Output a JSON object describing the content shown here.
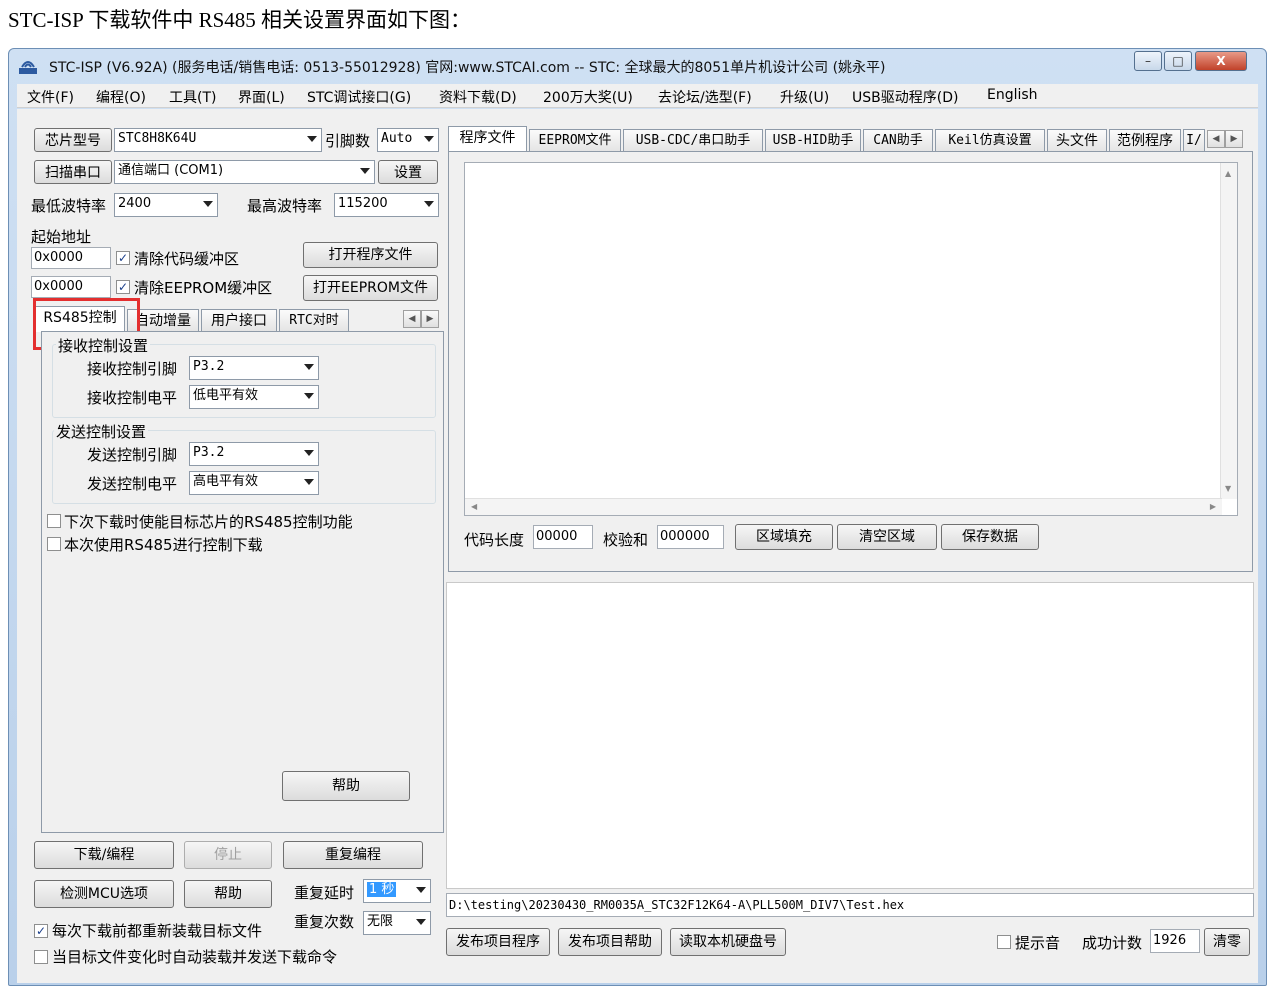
{
  "caption": "STC-ISP 下载软件中 RS485 相关设置界面如下图：",
  "window": {
    "title": "STC-ISP (V6.92A) (服务电话/销售电话: 0513-55012928) 官网:www.STCAI.com  -- STC: 全球最大的8051单片机设计公司 (姚永平)",
    "minimize": "–",
    "maximize": "□",
    "close": "X"
  },
  "menu": [
    "文件(F)",
    "编程(O)",
    "工具(T)",
    "界面(L)",
    "STC调试接口(G)",
    "资料下载(D)",
    "200万大奖(U)",
    "去论坛/选型(F)",
    "升级(U)",
    "USB驱动程序(D)",
    "English"
  ],
  "left": {
    "chip_label": "芯片型号",
    "chip_value": "STC8H8K64U",
    "pins_label": "引脚数",
    "pins_value": "Auto",
    "scan_label": "扫描串口",
    "port_value": "通信端口 (COM1)",
    "settings_label": "设置",
    "min_baud_label": "最低波特率",
    "min_baud_value": "2400",
    "max_baud_label": "最高波特率",
    "max_baud_value": "115200",
    "start_addr_label": "起始地址",
    "code_addr": "0x0000",
    "clear_code_label": "清除代码缓冲区",
    "open_prog_label": "打开程序文件",
    "eeprom_addr": "0x0000",
    "clear_eeprom_label": "清除EEPROM缓冲区",
    "open_eeprom_label": "打开EEPROM文件"
  },
  "sub_tabs": [
    "RS485控制",
    "自动增量",
    "用户接口",
    "RTC对时"
  ],
  "rs485": {
    "recv_group": "接收控制设置",
    "recv_pin_label": "接收控制引脚",
    "recv_pin_value": "P3.2",
    "recv_level_label": "接收控制电平",
    "recv_level_value": "低电平有效",
    "send_group": "发送控制设置",
    "send_pin_label": "发送控制引脚",
    "send_pin_value": "P3.2",
    "send_level_label": "发送控制电平",
    "send_level_value": "高电平有效",
    "opt1": "下次下载时使能目标芯片的RS485控制功能",
    "opt2": "本次使用RS485进行控制下载",
    "help_label": "帮助"
  },
  "bottom_left": {
    "download_label": "下载/编程",
    "stop_label": "停止",
    "reprogram_label": "重复编程",
    "detect_label": "检测MCU选项",
    "help_label": "帮助",
    "delay_label": "重复延时",
    "delay_value": "1 秒",
    "count_label": "重复次数",
    "count_value": "无限",
    "reload_label": "每次下载前都重新装载目标文件",
    "auto_label": "当目标文件变化时自动装载并发送下载命令"
  },
  "right_tabs": [
    "程序文件",
    "EEPROM文件",
    "USB-CDC/串口助手",
    "USB-HID助手",
    "CAN助手",
    "Keil仿真设置",
    "头文件",
    "范例程序",
    "I/"
  ],
  "code_area": {
    "length_label": "代码长度",
    "length_value": "00000",
    "checksum_label": "校验和",
    "checksum_value": "000000",
    "fill_label": "区域填充",
    "clear_label": "清空区域",
    "save_label": "保存数据"
  },
  "file_path": "D:\\testing\\20230430_RM0035A_STC32F12K64-A\\PLL500M_DIV7\\Test.hex",
  "status_bar": {
    "publish_prog": "发布项目程序",
    "publish_help": "发布项目帮助",
    "read_disk": "读取本机硬盘号",
    "beep_label": "提示音",
    "success_label": "成功计数",
    "success_value": "1926",
    "clear_label": "清零"
  },
  "colors": {
    "highlight_red": "#e32f2f",
    "selection_blue": "#3399ff"
  },
  "icons": [
    "app-icon",
    "check-icon",
    "chevron-down-icon",
    "scroll-left-icon",
    "scroll-right-icon",
    "scroll-up-icon",
    "scroll-down-icon"
  ]
}
